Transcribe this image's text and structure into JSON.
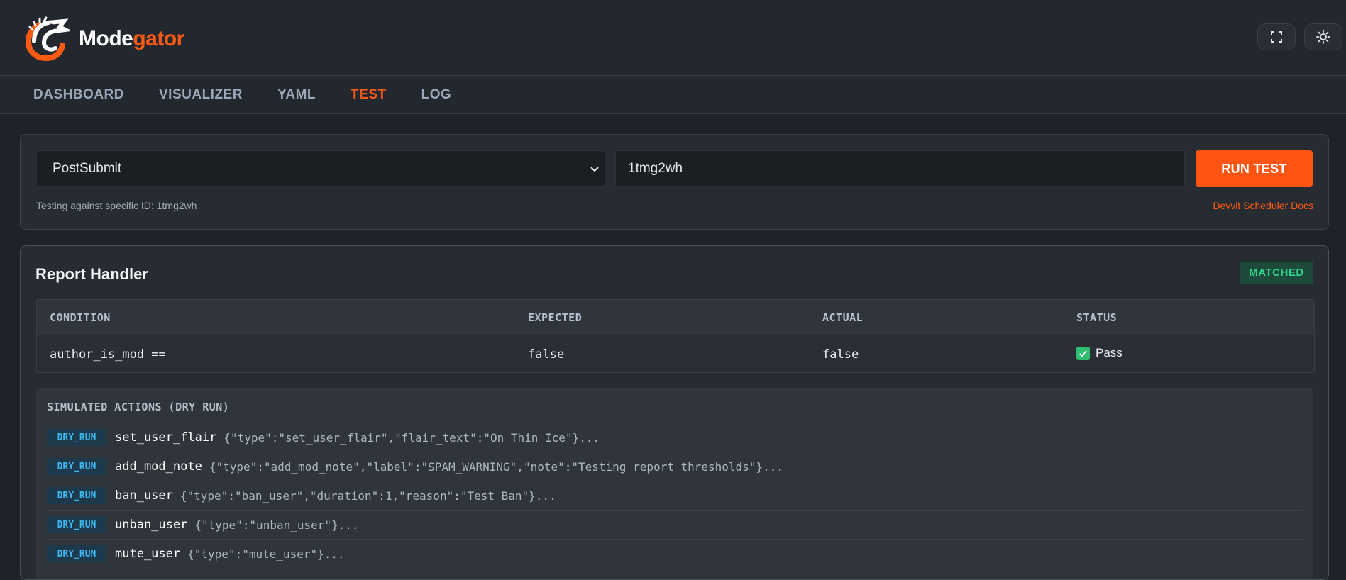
{
  "app": {
    "brand_part1": "Mode",
    "brand_part2": "gator",
    "accent": "#ff5a14"
  },
  "header": {
    "fullscreen_icon": "fullscreen-icon",
    "theme_icon": "sun-icon"
  },
  "nav": {
    "items": [
      {
        "label": "DASHBOARD",
        "active": false
      },
      {
        "label": "VISUALIZER",
        "active": false
      },
      {
        "label": "YAML",
        "active": false
      },
      {
        "label": "TEST",
        "active": true
      },
      {
        "label": "LOG",
        "active": false
      }
    ]
  },
  "test_form": {
    "event_select_value": "PostSubmit",
    "id_input_value": "1tmg2wh",
    "run_button": "RUN TEST",
    "hint": "Testing against specific ID: 1tmg2wh",
    "docs_link": "Devvit Scheduler Docs"
  },
  "result": {
    "title": "Report Handler",
    "badge": "MATCHED",
    "table": {
      "headers": [
        "CONDITION",
        "EXPECTED",
        "ACTUAL",
        "STATUS"
      ],
      "rows": [
        {
          "condition": "author_is_mod ==",
          "expected": "false",
          "actual": "false",
          "status": "Pass"
        }
      ]
    },
    "simulated": {
      "title": "SIMULATED ACTIONS (DRY RUN)",
      "badge": "DRY_RUN",
      "actions": [
        {
          "name": "set_user_flair",
          "payload": "{\"type\":\"set_user_flair\",\"flair_text\":\"On Thin Ice\"}..."
        },
        {
          "name": "add_mod_note",
          "payload": "{\"type\":\"add_mod_note\",\"label\":\"SPAM_WARNING\",\"note\":\"Testing report thresholds\"}..."
        },
        {
          "name": "ban_user",
          "payload": "{\"type\":\"ban_user\",\"duration\":1,\"reason\":\"Test Ban\"}..."
        },
        {
          "name": "unban_user",
          "payload": "{\"type\":\"unban_user\"}..."
        },
        {
          "name": "mute_user",
          "payload": "{\"type\":\"mute_user\"}..."
        }
      ]
    }
  }
}
